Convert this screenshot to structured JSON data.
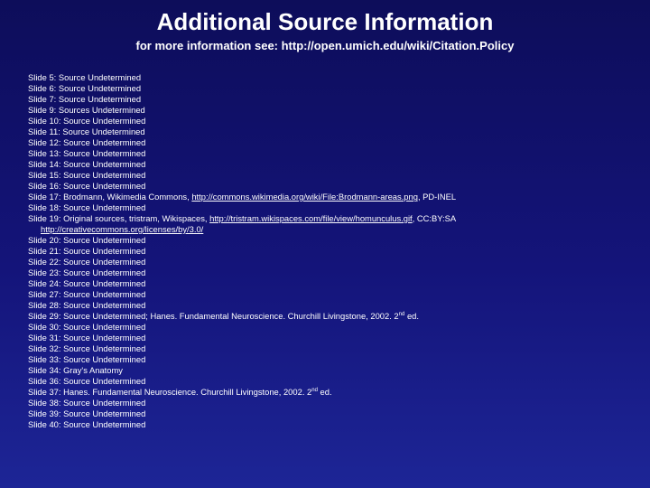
{
  "title": "Additional Source Information",
  "subtitle": "for more information see: http://open.umich.edu/wiki/Citation.Policy",
  "lines": [
    {
      "text": "Slide 5: Source Undetermined"
    },
    {
      "text": "Slide 6: Source Undetermined"
    },
    {
      "text": "Slide 7: Source Undetermined"
    },
    {
      "text": "Slide 9: Sources Undetermined"
    },
    {
      "text": "Slide 10: Source Undetermined"
    },
    {
      "text": "Slide 11: Source Undetermined"
    },
    {
      "text": "Slide 12: Source Undetermined"
    },
    {
      "text": "Slide 13: Source Undetermined"
    },
    {
      "text": "Slide 14: Source Undetermined"
    },
    {
      "text": "Slide 15: Source Undetermined"
    },
    {
      "text": "Slide 16: Source Undetermined"
    },
    {
      "text": "Slide 17: Brodmann, Wikimedia Commons, ",
      "link": "http://commons.wikimedia.org/wiki/File:Brodmann-areas.png",
      "after": ", PD-INEL"
    },
    {
      "text": "Slide 18: Source Undetermined"
    },
    {
      "text": "Slide 19: Original sources, tristram, Wikispaces, ",
      "link": "http://tristram.wikispaces.com/file/view/homunculus.gif",
      "after": ", CC:BY:SA"
    },
    {
      "text": "",
      "link": "http://creativecommons.org/licenses/by/3.0/",
      "indent": true
    },
    {
      "text": "Slide 20: Source Undetermined"
    },
    {
      "text": "Slide 21: Source Undetermined"
    },
    {
      "text": "Slide 22: Source Undetermined"
    },
    {
      "text": "Slide 23: Source Undetermined"
    },
    {
      "text": "Slide 24: Source Undetermined"
    },
    {
      "text": "Slide 27: Source Undetermined"
    },
    {
      "text": "Slide 28: Source Undetermined"
    },
    {
      "text": "Slide 29: Source Undetermined; Hanes. Fundamental Neuroscience. Churchill Livingstone, 2002. 2",
      "sup": "nd",
      "after": " ed."
    },
    {
      "text": "Slide 30: Source Undetermined"
    },
    {
      "text": "Slide 31: Source Undetermined"
    },
    {
      "text": "Slide 32: Source Undetermined"
    },
    {
      "text": "Slide 33: Source Undetermined"
    },
    {
      "text": "Slide 34: Gray's Anatomy"
    },
    {
      "text": "Slide 36: Source Undetermined"
    },
    {
      "text": "Slide 37: Hanes. Fundamental Neuroscience. Churchill Livingstone, 2002. 2",
      "sup": "nd",
      "after": " ed."
    },
    {
      "text": "Slide 38: Source Undetermined"
    },
    {
      "text": "Slide 39: Source Undetermined"
    },
    {
      "text": "Slide 40: Source Undetermined"
    }
  ]
}
